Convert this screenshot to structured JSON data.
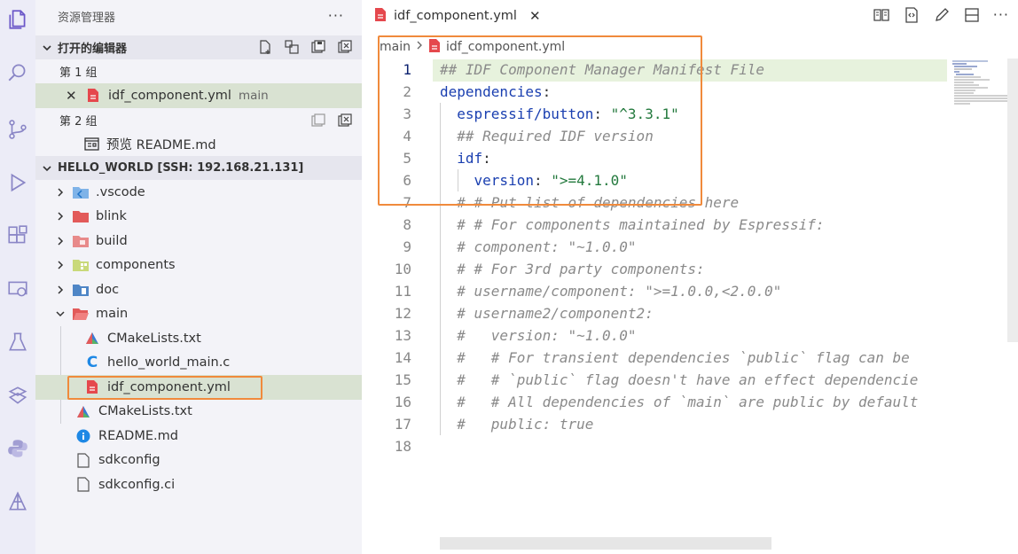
{
  "sidebar": {
    "title": "资源管理器",
    "more": "···",
    "open_editors": {
      "title": "打开的编辑器",
      "group1_label": "第 1 组",
      "group1_file": "idf_component.yml",
      "group1_desc": "main",
      "group2_label": "第 2 组",
      "group2_file": "预览 README.md"
    },
    "workspace": {
      "title": "HELLO_WORLD [SSH: 192.168.21.131]",
      "items": [
        {
          "label": ".vscode"
        },
        {
          "label": "blink"
        },
        {
          "label": "build"
        },
        {
          "label": "components"
        },
        {
          "label": "doc"
        },
        {
          "label": "main"
        },
        {
          "label": "CMakeLists.txt"
        },
        {
          "label": "hello_world_main.c"
        },
        {
          "label": "idf_component.yml"
        },
        {
          "label": "CMakeLists.txt"
        },
        {
          "label": "README.md"
        },
        {
          "label": "sdkconfig"
        },
        {
          "label": "sdkconfig.ci"
        }
      ]
    }
  },
  "editor": {
    "tab_label": "idf_component.yml",
    "close_glyph": "✕",
    "breadcrumb": {
      "folder": "main",
      "file": "idf_component.yml"
    },
    "lines": [
      {
        "n": "1",
        "parts": [
          {
            "t": "## IDF Component Manager Manifest File",
            "c": "c-comment"
          }
        ]
      },
      {
        "n": "2",
        "parts": [
          {
            "t": "dependencies",
            "c": "c-key"
          },
          {
            "t": ":",
            "c": "c-punc"
          }
        ]
      },
      {
        "n": "3",
        "parts": [
          {
            "t": "  espressif/button",
            "c": "c-key"
          },
          {
            "t": ": ",
            "c": "c-punc"
          },
          {
            "t": "\"^3.3.1\"",
            "c": "c-str"
          }
        ]
      },
      {
        "n": "4",
        "parts": [
          {
            "t": "  ## Required IDF version",
            "c": "c-comment"
          }
        ]
      },
      {
        "n": "5",
        "parts": [
          {
            "t": "  idf",
            "c": "c-key"
          },
          {
            "t": ":",
            "c": "c-punc"
          }
        ]
      },
      {
        "n": "6",
        "parts": [
          {
            "t": "    version",
            "c": "c-key"
          },
          {
            "t": ": ",
            "c": "c-punc"
          },
          {
            "t": "\">=4.1.0\"",
            "c": "c-str"
          }
        ]
      },
      {
        "n": "7",
        "parts": [
          {
            "t": "  # # Put list of dependencies here",
            "c": "c-comment"
          }
        ]
      },
      {
        "n": "8",
        "parts": [
          {
            "t": "  # # For components maintained by Espressif:",
            "c": "c-comment"
          }
        ]
      },
      {
        "n": "9",
        "parts": [
          {
            "t": "  # component: \"~1.0.0\"",
            "c": "c-comment"
          }
        ]
      },
      {
        "n": "10",
        "parts": [
          {
            "t": "  # # For 3rd party components:",
            "c": "c-comment"
          }
        ]
      },
      {
        "n": "11",
        "parts": [
          {
            "t": "  # username/component: \">=1.0.0,<2.0.0\"",
            "c": "c-comment"
          }
        ]
      },
      {
        "n": "12",
        "parts": [
          {
            "t": "  # username2/component2:",
            "c": "c-comment"
          }
        ]
      },
      {
        "n": "13",
        "parts": [
          {
            "t": "  #   version: \"~1.0.0\"",
            "c": "c-comment"
          }
        ]
      },
      {
        "n": "14",
        "parts": [
          {
            "t": "  #   # For transient dependencies `public` flag can be",
            "c": "c-comment"
          }
        ]
      },
      {
        "n": "15",
        "parts": [
          {
            "t": "  #   # `public` flag doesn't have an effect dependencie",
            "c": "c-comment"
          }
        ]
      },
      {
        "n": "16",
        "parts": [
          {
            "t": "  #   # All dependencies of `main` are public by default",
            "c": "c-comment"
          }
        ]
      },
      {
        "n": "17",
        "parts": [
          {
            "t": "  #   public: true",
            "c": "c-comment"
          }
        ]
      },
      {
        "n": "18",
        "parts": []
      }
    ]
  },
  "colors": {
    "accent_box": "#f08a3c",
    "yaml_icon": "#e5484d",
    "folder_red": "#e25a5a",
    "cmake": "#3a7bd5",
    "c_lang": "#1e88e5",
    "info": "#1e88e5"
  }
}
